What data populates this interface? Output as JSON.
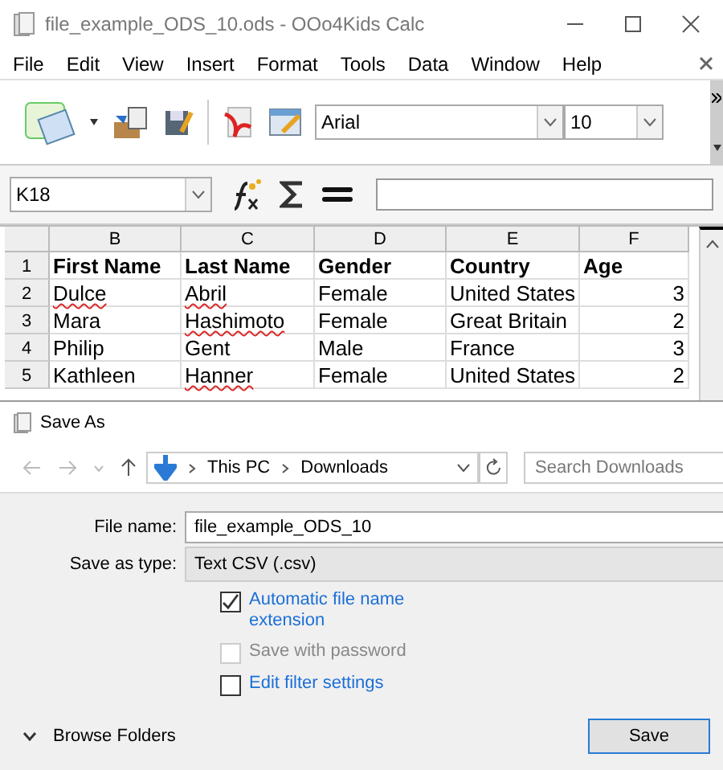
{
  "window": {
    "title": "file_example_ODS_10.ods - OOo4Kids Calc"
  },
  "menu": [
    "File",
    "Edit",
    "View",
    "Insert",
    "Format",
    "Tools",
    "Data",
    "Window",
    "Help"
  ],
  "toolbar": {
    "font": "Arial",
    "size": "10"
  },
  "formula_bar": {
    "cell_ref": "K18"
  },
  "sheet": {
    "columns": [
      "B",
      "C",
      "D",
      "E",
      "F"
    ],
    "header_row": {
      "number": "1",
      "cells": [
        "First Name",
        "Last Name",
        "Gender",
        "Country",
        "Age"
      ]
    },
    "rows": [
      {
        "number": "2",
        "cells": [
          {
            "text": "Dulce",
            "misspelled": true
          },
          {
            "text": "Abril",
            "misspelled": true
          },
          {
            "text": "Female",
            "misspelled": false
          },
          {
            "text": "United States",
            "misspelled": false
          },
          {
            "text": "3",
            "misspelled": false
          }
        ]
      },
      {
        "number": "3",
        "cells": [
          {
            "text": "Mara",
            "misspelled": false
          },
          {
            "text": "Hashimoto",
            "misspelled": true
          },
          {
            "text": "Female",
            "misspelled": false
          },
          {
            "text": "Great Britain",
            "misspelled": false
          },
          {
            "text": "2",
            "misspelled": false
          }
        ]
      },
      {
        "number": "4",
        "cells": [
          {
            "text": "Philip",
            "misspelled": false
          },
          {
            "text": "Gent",
            "misspelled": false
          },
          {
            "text": "Male",
            "misspelled": false
          },
          {
            "text": "France",
            "misspelled": false
          },
          {
            "text": "3",
            "misspelled": false
          }
        ]
      },
      {
        "number": "5",
        "cells": [
          {
            "text": "Kathleen",
            "misspelled": false
          },
          {
            "text": "Hanner",
            "misspelled": true
          },
          {
            "text": "Female",
            "misspelled": false
          },
          {
            "text": "United States",
            "misspelled": false
          },
          {
            "text": "2",
            "misspelled": false
          }
        ]
      }
    ]
  },
  "dialog": {
    "title": "Save As",
    "path": [
      "This PC",
      "Downloads"
    ],
    "search": {
      "placeholder": "Search Downloads"
    },
    "fields": [
      {
        "label": "File name:",
        "value": "file_example_ODS_10",
        "kind": "input"
      },
      {
        "label": "Save as type:",
        "value": "Text CSV (.csv)",
        "kind": "select"
      }
    ],
    "options": [
      {
        "label": "Automatic file name extension",
        "checked": true,
        "disabled": false
      },
      {
        "label": "Save with password",
        "checked": false,
        "disabled": true
      },
      {
        "label": "Edit filter settings",
        "checked": false,
        "disabled": false
      }
    ],
    "browse": "Browse Folders",
    "save_button": "Save"
  }
}
